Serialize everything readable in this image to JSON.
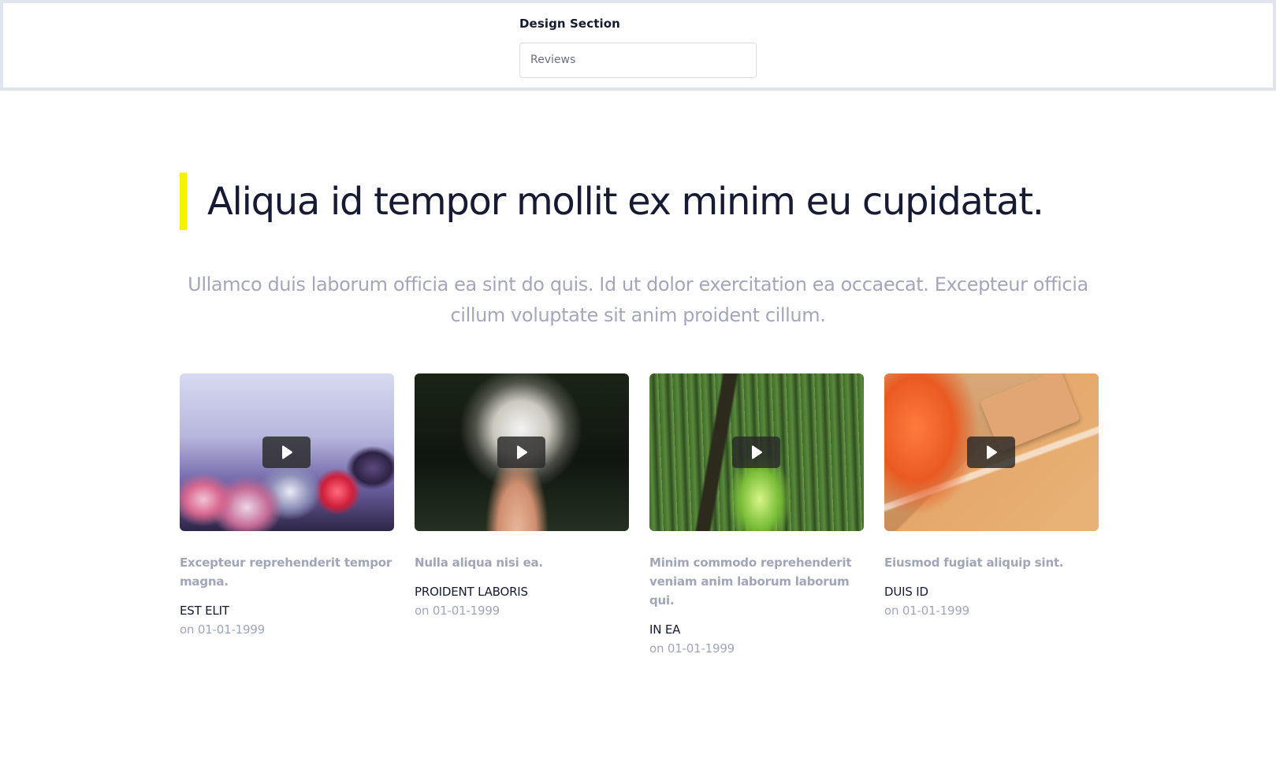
{
  "design_selector": {
    "label": "Design Section",
    "selected_value": "Reviews"
  },
  "heading": "Aliqua id tempor mollit ex minim eu cupidatat.",
  "subtitle": "Ullamco duis laborum officia ea sint do quis. Id ut dolor exercitation ea occaecat. Excepteur officia cillum voluptate sit anim proident cillum.",
  "colors": {
    "accent": "#f8f200",
    "heading": "#161a33",
    "muted": "#a4a7bb",
    "border": "#e1e3ee"
  },
  "cards": [
    {
      "image": "frozen-berries",
      "title": "Excepteur reprehenderit tempor magna.",
      "author": "EST ELIT",
      "date": "on 01-01-1999"
    },
    {
      "image": "dandelion",
      "title": "Nulla aliqua nisi ea.",
      "author": "PROIDENT LABORIS",
      "date": "on 01-01-1999"
    },
    {
      "image": "bamboo-forest",
      "title": "Minim commodo reprehenderit veniam anim laborum laborum qui.",
      "author": "IN EA",
      "date": "on 01-01-1999"
    },
    {
      "image": "wooden-desk",
      "title": "Eiusmod fugiat aliquip sint.",
      "author": "DUIS ID",
      "date": "on 01-01-1999"
    }
  ],
  "icons": {
    "play": "play-icon"
  }
}
